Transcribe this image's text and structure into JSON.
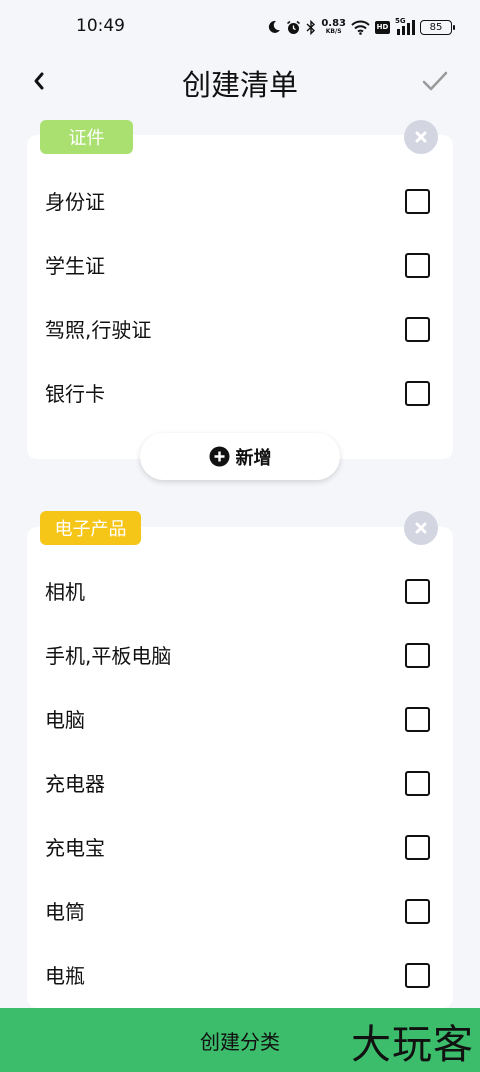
{
  "status_bar": {
    "time": "10:49",
    "net_speed_value": "0.83",
    "net_speed_unit": "KB/S",
    "hd": "HD",
    "signal_label": "5G",
    "battery": "85"
  },
  "header": {
    "title": "创建清单",
    "back_icon": "chevron-left-icon",
    "confirm_icon": "check-icon"
  },
  "categories": [
    {
      "name": "证件",
      "tag_color": "#a9e06f",
      "items": [
        "身份证",
        "学生证",
        "驾照,行驶证",
        "银行卡"
      ]
    },
    {
      "name": "电子产品",
      "tag_color": "#f5c518",
      "items": [
        "相机",
        "手机,平板电脑",
        "电脑",
        "充电器",
        "充电宝",
        "电筒",
        "电瓶"
      ]
    }
  ],
  "add_button": {
    "label": "新增",
    "icon": "plus-circle-icon"
  },
  "bottom_button": {
    "label": "创建分类"
  },
  "watermark": {
    "text": "大玩客"
  }
}
